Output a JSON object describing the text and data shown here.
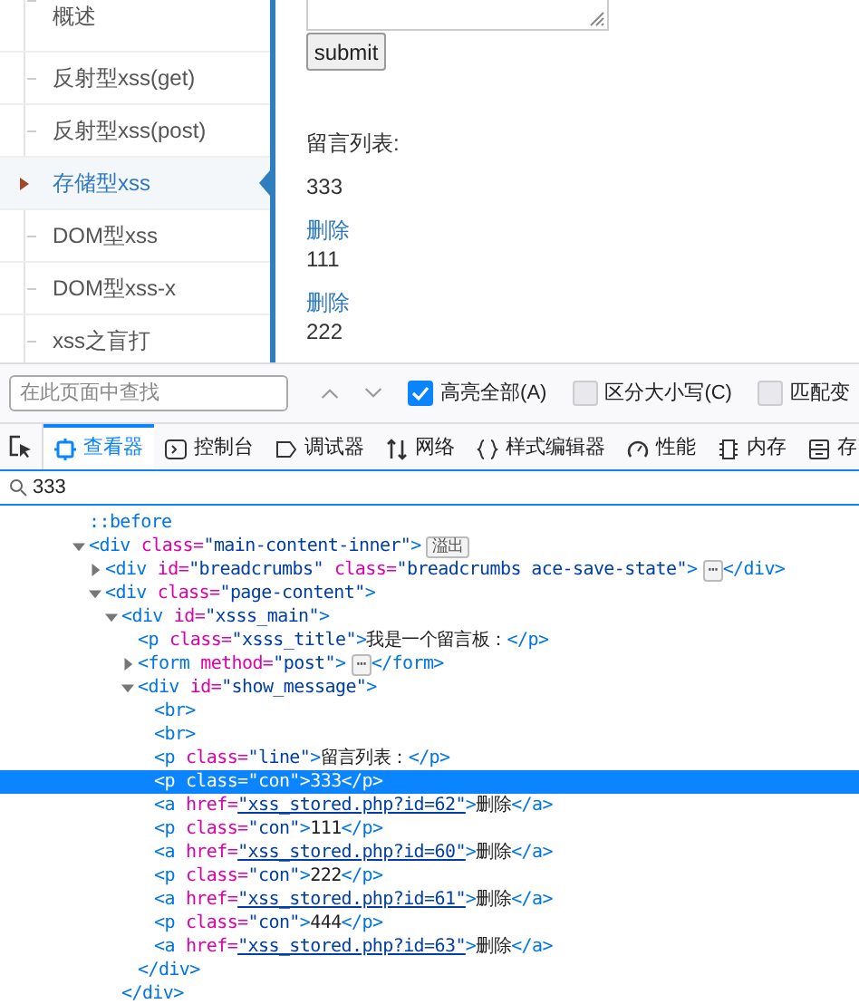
{
  "sidebar": {
    "items": [
      {
        "label": "概述",
        "selected": false
      },
      {
        "label": "反射型xss(get)",
        "selected": false
      },
      {
        "label": "反射型xss(post)",
        "selected": false
      },
      {
        "label": "存储型xss",
        "selected": true
      },
      {
        "label": "DOM型xss",
        "selected": false
      },
      {
        "label": "DOM型xss-x",
        "selected": false
      },
      {
        "label": "xss之盲打",
        "selected": false
      }
    ]
  },
  "content": {
    "submit_button": "submit",
    "list_title": "留言列表:",
    "messages": [
      {
        "text": "333"
      },
      {
        "delete_link": "删除",
        "text": "111"
      },
      {
        "delete_link": "删除",
        "text": "222"
      }
    ]
  },
  "find_bar": {
    "placeholder": "在此页面中查找",
    "options": [
      {
        "label": "高亮全部(A)",
        "checked": true
      },
      {
        "label": "区分大小写(C)",
        "checked": false
      },
      {
        "label": "匹配变",
        "checked": false
      }
    ]
  },
  "devtools": {
    "tabs": [
      {
        "label": "查看器",
        "selected": true,
        "kind": "inspector"
      },
      {
        "label": "控制台",
        "selected": false,
        "kind": "console"
      },
      {
        "label": "调试器",
        "selected": false,
        "kind": "debugger"
      },
      {
        "label": "网络",
        "selected": false,
        "kind": "network"
      },
      {
        "label": "样式编辑器",
        "selected": false,
        "kind": "style"
      },
      {
        "label": "性能",
        "selected": false,
        "kind": "performance"
      },
      {
        "label": "内存",
        "selected": false,
        "kind": "memory"
      },
      {
        "label": "存",
        "selected": false,
        "kind": "storage"
      }
    ],
    "search": {
      "value": "333"
    },
    "tree": [
      {
        "parts": [
          {
            "kind": "pseudo",
            "t": "::before"
          }
        ]
      },
      {
        "expanded": true,
        "parts": [
          {
            "kind": "tag",
            "t": "<div"
          },
          {
            "kind": "attr",
            "t": "class="
          },
          {
            "kind": "value",
            "t": "\"main-content-inner\""
          },
          {
            "kind": "tag",
            "t": ">"
          },
          {
            "kind": "badge",
            "t": "溢出"
          }
        ],
        "children": [
          {
            "expanded": false,
            "parts": [
              {
                "kind": "tag",
                "t": "<div"
              },
              {
                "kind": "attr",
                "t": "id="
              },
              {
                "kind": "value",
                "t": "\"breadcrumbs\""
              },
              {
                "kind": "attr",
                "t": "class="
              },
              {
                "kind": "value",
                "t": "\"breadcrumbs ace-save-state\""
              },
              {
                "kind": "tag",
                "t": ">"
              },
              {
                "kind": "badge",
                "t": "⋯"
              },
              {
                "kind": "tag",
                "t": "</div>"
              }
            ]
          },
          {
            "expanded": true,
            "parts": [
              {
                "kind": "tag",
                "t": "<div"
              },
              {
                "kind": "attr",
                "t": "class="
              },
              {
                "kind": "value",
                "t": "\"page-content\""
              },
              {
                "kind": "tag",
                "t": ">"
              }
            ],
            "children": [
              {
                "expanded": true,
                "parts": [
                  {
                    "kind": "tag",
                    "t": "<div"
                  },
                  {
                    "kind": "attr",
                    "t": "id="
                  },
                  {
                    "kind": "value",
                    "t": "\"xsss_main\""
                  },
                  {
                    "kind": "tag",
                    "t": ">"
                  }
                ],
                "children": [
                  {
                    "parts": [
                      {
                        "kind": "tag",
                        "t": "<p"
                      },
                      {
                        "kind": "attr",
                        "t": "class="
                      },
                      {
                        "kind": "value",
                        "t": "\"xsss_title\""
                      },
                      {
                        "kind": "tag",
                        "t": ">"
                      },
                      {
                        "kind": "text",
                        "t": "我是一个留言板："
                      },
                      {
                        "kind": "tag",
                        "t": "</p>"
                      }
                    ]
                  },
                  {
                    "expanded": false,
                    "parts": [
                      {
                        "kind": "tag",
                        "t": "<form"
                      },
                      {
                        "kind": "attr",
                        "t": "method="
                      },
                      {
                        "kind": "value",
                        "t": "\"post\""
                      },
                      {
                        "kind": "tag",
                        "t": ">"
                      },
                      {
                        "kind": "badge",
                        "t": "⋯"
                      },
                      {
                        "kind": "tag",
                        "t": "</form>"
                      }
                    ]
                  },
                  {
                    "expanded": true,
                    "parts": [
                      {
                        "kind": "tag",
                        "t": "<div"
                      },
                      {
                        "kind": "attr",
                        "t": "id="
                      },
                      {
                        "kind": "value",
                        "t": "\"show_message\""
                      },
                      {
                        "kind": "tag",
                        "t": ">"
                      }
                    ],
                    "children": [
                      {
                        "parts": [
                          {
                            "kind": "tag",
                            "t": "<br>"
                          }
                        ]
                      },
                      {
                        "parts": [
                          {
                            "kind": "tag",
                            "t": "<br>"
                          }
                        ]
                      },
                      {
                        "parts": [
                          {
                            "kind": "tag",
                            "t": "<p"
                          },
                          {
                            "kind": "attr",
                            "t": "class="
                          },
                          {
                            "kind": "value",
                            "t": "\"line\""
                          },
                          {
                            "kind": "tag",
                            "t": ">"
                          },
                          {
                            "kind": "text",
                            "t": "留言列表："
                          },
                          {
                            "kind": "tag",
                            "t": "</p>"
                          }
                        ]
                      },
                      {
                        "selected": true,
                        "parts": [
                          {
                            "kind": "tag",
                            "t": "<p"
                          },
                          {
                            "kind": "attr",
                            "t": "class="
                          },
                          {
                            "kind": "value",
                            "t": "\"con\""
                          },
                          {
                            "kind": "tag",
                            "t": ">"
                          },
                          {
                            "kind": "text",
                            "t": "333"
                          },
                          {
                            "kind": "tag",
                            "t": "</p>"
                          }
                        ]
                      },
                      {
                        "parts": [
                          {
                            "kind": "tag",
                            "t": "<a"
                          },
                          {
                            "kind": "attr",
                            "t": "href="
                          },
                          {
                            "kind": "link",
                            "t": "\"xss_stored.php?id=62\""
                          },
                          {
                            "kind": "tag",
                            "t": ">"
                          },
                          {
                            "kind": "text",
                            "t": "删除"
                          },
                          {
                            "kind": "tag",
                            "t": "</a>"
                          }
                        ]
                      },
                      {
                        "parts": [
                          {
                            "kind": "tag",
                            "t": "<p"
                          },
                          {
                            "kind": "attr",
                            "t": "class="
                          },
                          {
                            "kind": "value",
                            "t": "\"con\""
                          },
                          {
                            "kind": "tag",
                            "t": ">"
                          },
                          {
                            "kind": "text",
                            "t": "111"
                          },
                          {
                            "kind": "tag",
                            "t": "</p>"
                          }
                        ]
                      },
                      {
                        "parts": [
                          {
                            "kind": "tag",
                            "t": "<a"
                          },
                          {
                            "kind": "attr",
                            "t": "href="
                          },
                          {
                            "kind": "link",
                            "t": "\"xss_stored.php?id=60\""
                          },
                          {
                            "kind": "tag",
                            "t": ">"
                          },
                          {
                            "kind": "text",
                            "t": "删除"
                          },
                          {
                            "kind": "tag",
                            "t": "</a>"
                          }
                        ]
                      },
                      {
                        "parts": [
                          {
                            "kind": "tag",
                            "t": "<p"
                          },
                          {
                            "kind": "attr",
                            "t": "class="
                          },
                          {
                            "kind": "value",
                            "t": "\"con\""
                          },
                          {
                            "kind": "tag",
                            "t": ">"
                          },
                          {
                            "kind": "text",
                            "t": "222"
                          },
                          {
                            "kind": "tag",
                            "t": "</p>"
                          }
                        ]
                      },
                      {
                        "parts": [
                          {
                            "kind": "tag",
                            "t": "<a"
                          },
                          {
                            "kind": "attr",
                            "t": "href="
                          },
                          {
                            "kind": "link",
                            "t": "\"xss_stored.php?id=61\""
                          },
                          {
                            "kind": "tag",
                            "t": ">"
                          },
                          {
                            "kind": "text",
                            "t": "删除"
                          },
                          {
                            "kind": "tag",
                            "t": "</a>"
                          }
                        ]
                      },
                      {
                        "parts": [
                          {
                            "kind": "tag",
                            "t": "<p"
                          },
                          {
                            "kind": "attr",
                            "t": "class="
                          },
                          {
                            "kind": "value",
                            "t": "\"con\""
                          },
                          {
                            "kind": "tag",
                            "t": ">"
                          },
                          {
                            "kind": "text",
                            "t": "444"
                          },
                          {
                            "kind": "tag",
                            "t": "</p>"
                          }
                        ]
                      },
                      {
                        "parts": [
                          {
                            "kind": "tag",
                            "t": "<a"
                          },
                          {
                            "kind": "attr",
                            "t": "href="
                          },
                          {
                            "kind": "link",
                            "t": "\"xss_stored.php?id=63\""
                          },
                          {
                            "kind": "tag",
                            "t": ">"
                          },
                          {
                            "kind": "text",
                            "t": "删除"
                          },
                          {
                            "kind": "tag",
                            "t": "</a>"
                          }
                        ]
                      }
                    ],
                    "close": "</div>"
                  }
                ],
                "close": "</div>"
              }
            ]
          }
        ]
      }
    ]
  }
}
